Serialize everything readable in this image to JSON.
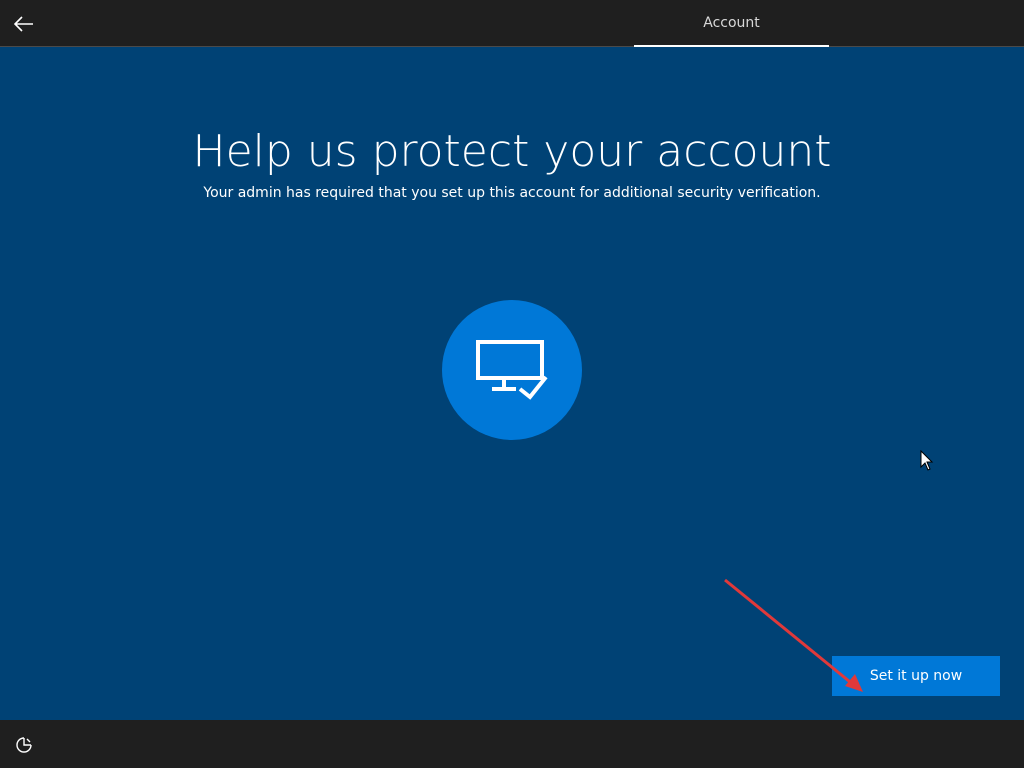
{
  "header": {
    "back_icon": "back-arrow-icon",
    "tab_label": "Account"
  },
  "main": {
    "title": "Help us protect your account",
    "subtitle": "Your admin has required that you set up this account for additional security verification.",
    "hero_icon": "monitor-check-icon",
    "primary_button": "Set it up now"
  },
  "footer": {
    "ease_of_access_icon": "ease-of-access-icon"
  },
  "colors": {
    "background": "#004275",
    "bar": "#1f1f1f",
    "accent": "#0078d7",
    "annotation": "#e0393a"
  }
}
